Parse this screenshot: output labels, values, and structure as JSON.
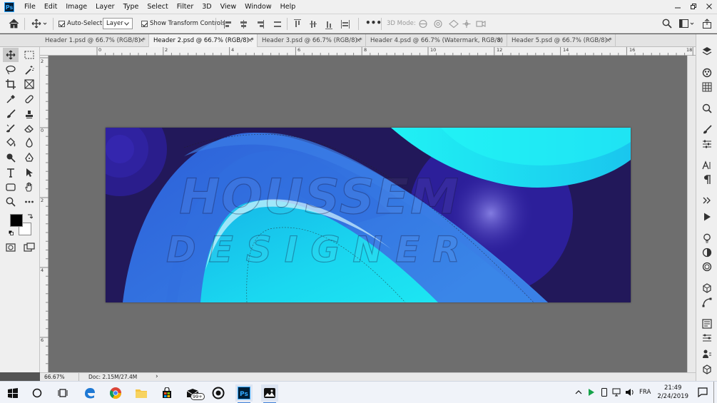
{
  "app": {
    "name": "Photoshop",
    "logo_text": "Ps"
  },
  "menu": [
    "File",
    "Edit",
    "Image",
    "Layer",
    "Type",
    "Select",
    "Filter",
    "3D",
    "View",
    "Window",
    "Help"
  ],
  "options": {
    "auto_select_label": "Auto-Select:",
    "auto_select_checked": true,
    "auto_select_target": "Layer",
    "show_transform_label": "Show Transform Controls",
    "show_transform_checked": true,
    "mode_3d_label": "3D Mode:"
  },
  "tabs": [
    {
      "label": "Header 1.psd @ 66.7% (RGB/8) *",
      "active": false
    },
    {
      "label": "Header 2.psd @ 66.7% (RGB/8) *",
      "active": true
    },
    {
      "label": "Header 3.psd @ 66.7% (RGB/8) *",
      "active": false
    },
    {
      "label": "Header 4.psd @ 66.7% (Watermark, RGB/8) *",
      "active": false
    },
    {
      "label": "Header 5.psd @ 66.7% (RGB/8) *",
      "active": false
    }
  ],
  "tab_close": "×",
  "ruler": {
    "h_labels": [
      "0",
      "2",
      "4",
      "6",
      "8",
      "10",
      "12",
      "14",
      "16",
      "18"
    ],
    "v_labels": [
      "2",
      "0",
      "2",
      "4",
      "6"
    ]
  },
  "canvas": {
    "watermark_line1": "HOUSSEM",
    "watermark_line2": "DESIGNER",
    "colors": {
      "bg": "#22185a",
      "purple": "#2c1f9a",
      "blue": "#2f6fdc",
      "cyan": "#19e6f2"
    }
  },
  "status": {
    "zoom": "66.67%",
    "doc": "Doc: 2.15M/27.4M",
    "arrow": "›"
  },
  "swatches": {
    "foreground": "#000000",
    "background": "#ffffff"
  },
  "taskbar": {
    "badge": "99+",
    "time": "21:49",
    "date": "2/24/2019",
    "lang": "FRA"
  }
}
